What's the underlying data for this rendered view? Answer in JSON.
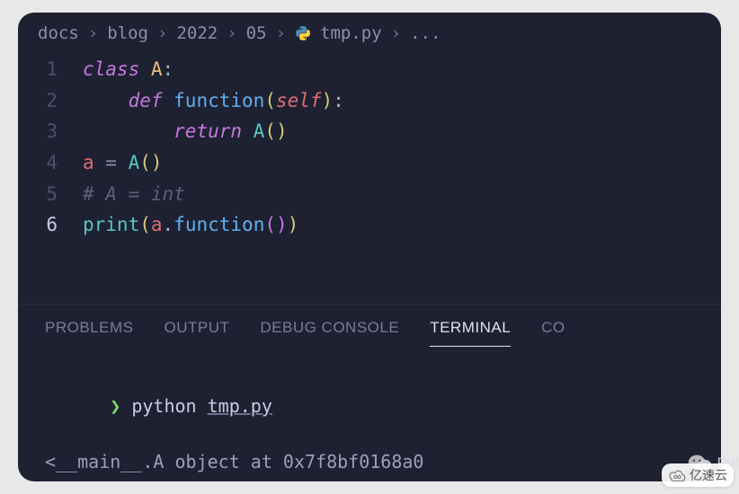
{
  "breadcrumb": {
    "items": [
      "docs",
      "blog",
      "2022",
      "05",
      "tmp.py",
      "..."
    ],
    "sep": "›"
  },
  "code": {
    "lines": [
      {
        "n": "1",
        "tokens": [
          {
            "t": "class ",
            "c": "tok-kw"
          },
          {
            "t": "A",
            "c": "tok-class"
          },
          {
            "t": ":",
            "c": "tok-punct"
          }
        ]
      },
      {
        "n": "2",
        "indent": 1,
        "tokens": [
          {
            "t": "def ",
            "c": "tok-def"
          },
          {
            "t": "function",
            "c": "tok-func"
          },
          {
            "t": "(",
            "c": "tok-punct-y"
          },
          {
            "t": "self",
            "c": "tok-self"
          },
          {
            "t": ")",
            "c": "tok-punct-y"
          },
          {
            "t": ":",
            "c": "tok-punct"
          }
        ]
      },
      {
        "n": "3",
        "indent": 2,
        "tokens": [
          {
            "t": "return ",
            "c": "tok-ret"
          },
          {
            "t": "A",
            "c": "tok-call"
          },
          {
            "t": "()",
            "c": "tok-punct-y"
          }
        ]
      },
      {
        "n": "4",
        "tokens": [
          {
            "t": "a",
            "c": "tok-var"
          },
          {
            "t": " = ",
            "c": "tok-op"
          },
          {
            "t": "A",
            "c": "tok-call"
          },
          {
            "t": "()",
            "c": "tok-punct-y"
          }
        ]
      },
      {
        "n": "5",
        "tokens": [
          {
            "t": "# A = int",
            "c": "tok-comment"
          }
        ]
      },
      {
        "n": "6",
        "active": true,
        "tokens": [
          {
            "t": "print",
            "c": "tok-print"
          },
          {
            "t": "(",
            "c": "tok-punct-y"
          },
          {
            "t": "a",
            "c": "tok-var"
          },
          {
            "t": ".",
            "c": "tok-punct"
          },
          {
            "t": "function",
            "c": "tok-func"
          },
          {
            "t": "()",
            "c": "tok-punct-p"
          },
          {
            "t": ")",
            "c": "tok-punct-y"
          }
        ]
      }
    ]
  },
  "panel": {
    "tabs": [
      "PROBLEMS",
      "OUTPUT",
      "DEBUG CONSOLE",
      "TERMINAL",
      "CO"
    ],
    "active": 3
  },
  "terminal": {
    "prompt": "❯",
    "command": "python",
    "arg": "tmp.py",
    "output": "<__main__.A object at 0x7f8bf0168a0"
  },
  "watermark": {
    "text": "Pyt"
  },
  "badge": {
    "text": "亿速云"
  }
}
